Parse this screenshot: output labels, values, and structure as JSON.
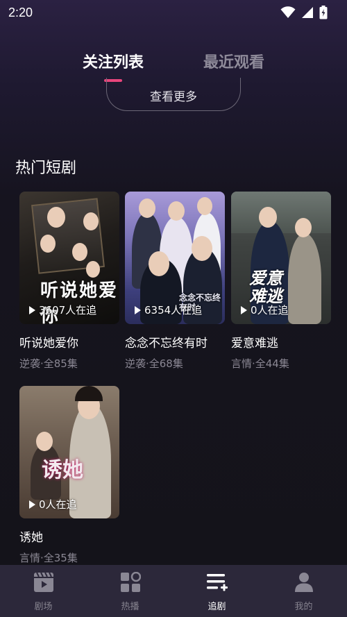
{
  "status": {
    "time": "2:20"
  },
  "tabs": [
    {
      "label": "关注列表",
      "active": true
    },
    {
      "label": "最近观看",
      "active": false
    }
  ],
  "more_button": "查看更多",
  "section_title": "热门短剧",
  "dramas": [
    {
      "title": "听说她爱你",
      "meta": "逆袭·全85集",
      "viewers": "3607人在追",
      "poster_text": "听说她爱你"
    },
    {
      "title": "念念不忘终有时",
      "meta": "逆袭·全68集",
      "viewers": "6354人在追",
      "poster_text": "念念不忘终有时"
    },
    {
      "title": "爱意难逃",
      "meta": "言情·全44集",
      "viewers": "0人在追",
      "poster_text": "爱意难逃"
    },
    {
      "title": "诱她",
      "meta": "言情·全35集",
      "viewers": "0人在追",
      "poster_text": "诱她"
    }
  ],
  "nav": [
    {
      "label": "剧场",
      "icon": "theater-icon",
      "active": false
    },
    {
      "label": "热播",
      "icon": "grid-icon",
      "active": false
    },
    {
      "label": "追剧",
      "icon": "playlist-add-icon",
      "active": true
    },
    {
      "label": "我的",
      "icon": "person-icon",
      "active": false
    }
  ],
  "colors": {
    "accent": "#e8457c",
    "nav_bg": "#2c283a",
    "muted": "#8a8793"
  }
}
